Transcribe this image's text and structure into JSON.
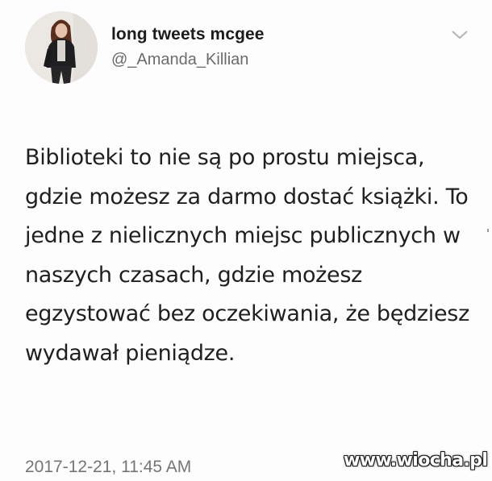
{
  "tweet": {
    "author": {
      "display_name": "long tweets mcgee",
      "handle": "@_Amanda_Killian",
      "avatar_icon": "profile-photo"
    },
    "menu_icon": "chevron-down-icon",
    "text": "Biblioteki to nie są po prostu miejsca, gdzie możesz za darmo dostać książki. To jedne z nielicznych miejsc publicznych w naszych czasach, gdzie możesz egzystować bez oczekiwania, że będziesz wydawał pieniądze.",
    "timestamp": "2017-12-21, 11:45 AM"
  },
  "watermark": {
    "text": "www.wiocha.pl"
  }
}
